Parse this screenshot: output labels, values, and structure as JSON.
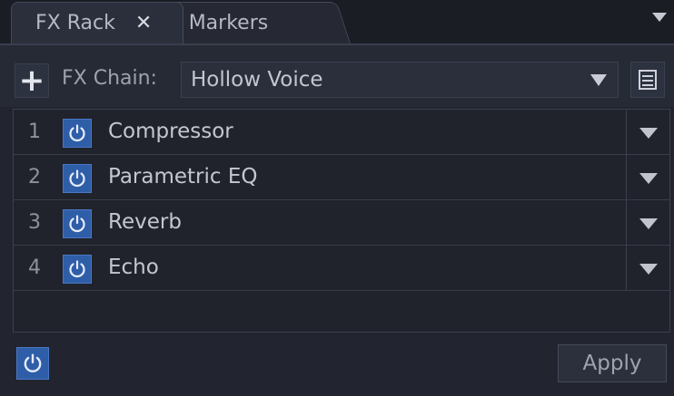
{
  "tabs": [
    {
      "label": "FX Rack",
      "close_icon": "close-icon",
      "active": true
    },
    {
      "label": "Markers",
      "active": false
    }
  ],
  "toolbar": {
    "add_icon": "plus-icon",
    "chain_label": "FX Chain:",
    "chain_value": "Hollow Voice",
    "list_icon": "list-icon"
  },
  "effects": [
    {
      "index": "1",
      "name": "Compressor",
      "enabled": true
    },
    {
      "index": "2",
      "name": "Parametric EQ",
      "enabled": true
    },
    {
      "index": "3",
      "name": "Reverb",
      "enabled": true
    },
    {
      "index": "4",
      "name": "Echo",
      "enabled": true
    }
  ],
  "footer": {
    "master_power_icon": "power-icon",
    "apply_label": "Apply"
  },
  "colors": {
    "background": "#22252f",
    "accent_blue": "#2f5ea8",
    "text": "#c4c7d0"
  }
}
